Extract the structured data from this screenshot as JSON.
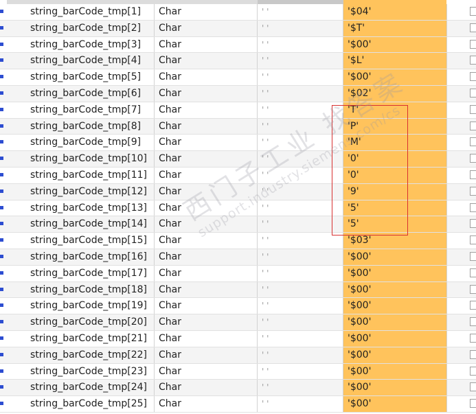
{
  "watermark": {
    "chinese": "西门子工业 找答案",
    "url": "support.industry.siemens.com/cs"
  },
  "colors": {
    "monitor_bg": "#ffc35c",
    "marker": "#2d4dd1",
    "highlight_border": "#d83030"
  },
  "rows": [
    {
      "name": "string_barCode_tmp[1]",
      "type": "Char",
      "start": "' '",
      "monitor": "'$04'"
    },
    {
      "name": "string_barCode_tmp[2]",
      "type": "Char",
      "start": "' '",
      "monitor": "'$T'"
    },
    {
      "name": "string_barCode_tmp[3]",
      "type": "Char",
      "start": "' '",
      "monitor": "'$00'"
    },
    {
      "name": "string_barCode_tmp[4]",
      "type": "Char",
      "start": "' '",
      "monitor": "'$L'"
    },
    {
      "name": "string_barCode_tmp[5]",
      "type": "Char",
      "start": "' '",
      "monitor": "'$00'"
    },
    {
      "name": "string_barCode_tmp[6]",
      "type": "Char",
      "start": "' '",
      "monitor": "'$02'"
    },
    {
      "name": "string_barCode_tmp[7]",
      "type": "Char",
      "start": "' '",
      "monitor": "'T'"
    },
    {
      "name": "string_barCode_tmp[8]",
      "type": "Char",
      "start": "' '",
      "monitor": "'P'"
    },
    {
      "name": "string_barCode_tmp[9]",
      "type": "Char",
      "start": "' '",
      "monitor": "'M'"
    },
    {
      "name": "string_barCode_tmp[10]",
      "type": "Char",
      "start": "' '",
      "monitor": "'0'"
    },
    {
      "name": "string_barCode_tmp[11]",
      "type": "Char",
      "start": "' '",
      "monitor": "'0'"
    },
    {
      "name": "string_barCode_tmp[12]",
      "type": "Char",
      "start": "' '",
      "monitor": "'9'"
    },
    {
      "name": "string_barCode_tmp[13]",
      "type": "Char",
      "start": "' '",
      "monitor": "'5'"
    },
    {
      "name": "string_barCode_tmp[14]",
      "type": "Char",
      "start": "' '",
      "monitor": "'5'"
    },
    {
      "name": "string_barCode_tmp[15]",
      "type": "Char",
      "start": "' '",
      "monitor": "'$03'"
    },
    {
      "name": "string_barCode_tmp[16]",
      "type": "Char",
      "start": "' '",
      "monitor": "'$00'"
    },
    {
      "name": "string_barCode_tmp[17]",
      "type": "Char",
      "start": "' '",
      "monitor": "'$00'"
    },
    {
      "name": "string_barCode_tmp[18]",
      "type": "Char",
      "start": "' '",
      "monitor": "'$00'"
    },
    {
      "name": "string_barCode_tmp[19]",
      "type": "Char",
      "start": "' '",
      "monitor": "'$00'"
    },
    {
      "name": "string_barCode_tmp[20]",
      "type": "Char",
      "start": "' '",
      "monitor": "'$00'"
    },
    {
      "name": "string_barCode_tmp[21]",
      "type": "Char",
      "start": "' '",
      "monitor": "'$00'"
    },
    {
      "name": "string_barCode_tmp[22]",
      "type": "Char",
      "start": "' '",
      "monitor": "'$00'"
    },
    {
      "name": "string_barCode_tmp[23]",
      "type": "Char",
      "start": "' '",
      "monitor": "'$00'"
    },
    {
      "name": "string_barCode_tmp[24]",
      "type": "Char",
      "start": "' '",
      "monitor": "'$00'"
    },
    {
      "name": "string_barCode_tmp[25]",
      "type": "Char",
      "start": "' '",
      "monitor": "'$00'"
    }
  ]
}
